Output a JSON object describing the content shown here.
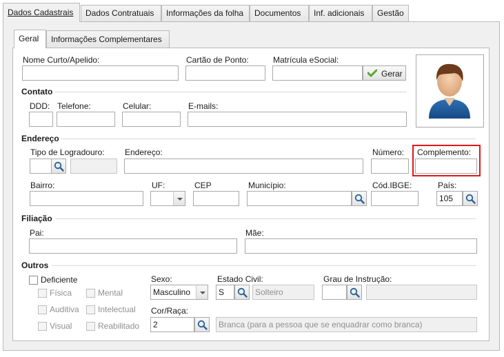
{
  "tabs": [
    {
      "label": "Dados Cadastrais"
    },
    {
      "label": "Dados Contratuais"
    },
    {
      "label": "Informações da folha"
    },
    {
      "label": "Documentos"
    },
    {
      "label": "Inf. adicionais"
    },
    {
      "label": "Gestão"
    }
  ],
  "subtabs": [
    {
      "label": "Geral"
    },
    {
      "label": "Informações Complementares"
    }
  ],
  "identificacao": {
    "nome_curto_label": "Nome Curto/Apelido:",
    "cartao_ponto_label": "Cartão de Ponto:",
    "matricula_label": "Matrícula eSocial:",
    "gerar_label": "Gerar"
  },
  "contato": {
    "title": "Contato",
    "ddd_label": "DDD:",
    "telefone_label": "Telefone:",
    "celular_label": "Celular:",
    "emails_label": "E-mails:"
  },
  "endereco": {
    "title": "Endereço",
    "tipo_logradouro_label": "Tipo de Logradouro:",
    "endereco_label": "Endereço:",
    "numero_label": "Número:",
    "complemento_label": "Complemento:",
    "bairro_label": "Bairro:",
    "uf_label": "UF:",
    "cep_label": "CEP",
    "municipio_label": "Município:",
    "cod_ibge_label": "Cód.IBGE:",
    "pais_label": "País:",
    "pais_value": "105"
  },
  "filiacao": {
    "title": "Filiação",
    "pai_label": "Pai:",
    "mae_label": "Mãe:"
  },
  "outros": {
    "title": "Outros",
    "deficiente_label": "Deficiente",
    "fisica_label": "Física",
    "mental_label": "Mental",
    "auditiva_label": "Auditiva",
    "intelectual_label": "Intelectual",
    "visual_label": "Visual",
    "reabilitado_label": "Reabilitado",
    "sexo_label": "Sexo:",
    "sexo_value": "Masculino",
    "estado_civil_label": "Estado Civil:",
    "estado_civil_code": "S",
    "estado_civil_desc": "Solteiro",
    "grau_instrucao_label": "Grau de Instrução:",
    "cor_raca_label": "Cor/Raça:",
    "cor_raca_code": "2",
    "cor_raca_desc": "Branca (para a pessoa que se enquadrar como branca)"
  },
  "colors": {
    "highlight": "#e0161b",
    "panel_bg": "#f0f0f0",
    "gerar_check": "#5aa52a"
  },
  "icons": [
    "search-icon",
    "check-icon",
    "user-avatar-icon",
    "chevron-down-icon"
  ]
}
